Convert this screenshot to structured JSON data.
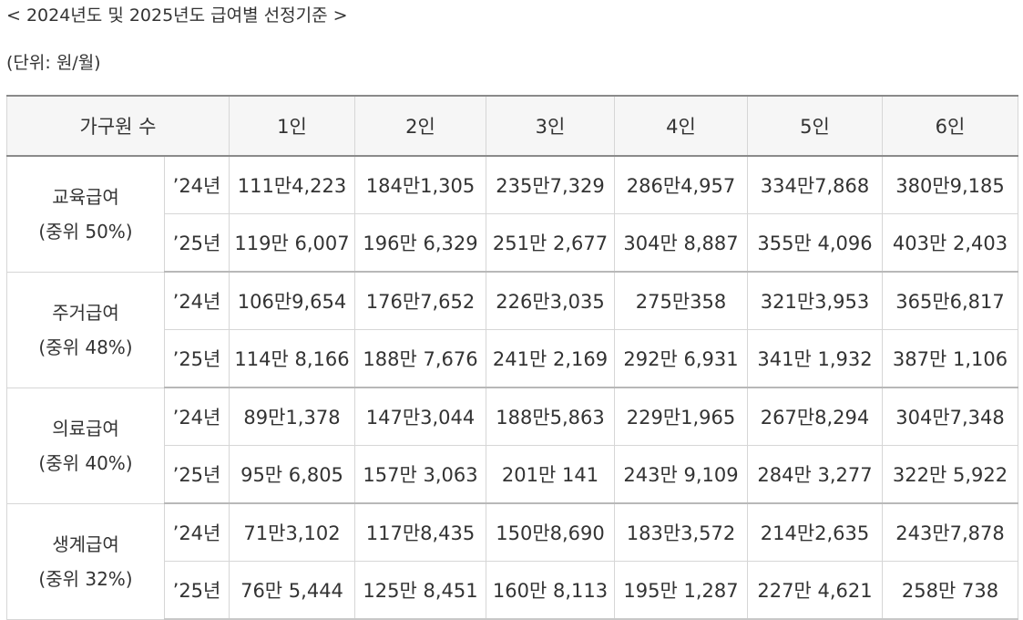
{
  "title": "< 2024년도 및 2025년도 급여별 선정기준 >",
  "unit": "(단위: 원/월)",
  "table": {
    "header_household": "가구원 수",
    "headers": [
      "1인",
      "2인",
      "3인",
      "4인",
      "5인",
      "6인"
    ],
    "groups": [
      {
        "name": "교육급여",
        "ratio": "(중위 50%)",
        "rows": [
          {
            "year": "’24년",
            "values": [
              "111만4,223",
              "184만1,305",
              "235만7,329",
              "286만4,957",
              "334만7,868",
              "380만9,185"
            ]
          },
          {
            "year": "’25년",
            "values": [
              "119만 6,007",
              "196만 6,329",
              "251만 2,677",
              "304만 8,887",
              "355만 4,096",
              "403만 2,403"
            ]
          }
        ]
      },
      {
        "name": "주거급여",
        "ratio": "(중위 48%)",
        "rows": [
          {
            "year": "’24년",
            "values": [
              "106만9,654",
              "176만7,652",
              "226만3,035",
              "275만358",
              "321만3,953",
              "365만6,817"
            ]
          },
          {
            "year": "’25년",
            "values": [
              "114만 8,166",
              "188만 7,676",
              "241만 2,169",
              "292만 6,931",
              "341만 1,932",
              "387만 1,106"
            ]
          }
        ]
      },
      {
        "name": "의료급여",
        "ratio": "(중위 40%)",
        "rows": [
          {
            "year": "’24년",
            "values": [
              "89만1,378",
              "147만3,044",
              "188만5,863",
              "229만1,965",
              "267만8,294",
              "304만7,348"
            ]
          },
          {
            "year": "’25년",
            "values": [
              "95만 6,805",
              "157만 3,063",
              "201만 141",
              "243만 9,109",
              "284만 3,277",
              "322만 5,922"
            ]
          }
        ]
      },
      {
        "name": "생계급여",
        "ratio": "(중위 32%)",
        "rows": [
          {
            "year": "’24년",
            "values": [
              "71만3,102",
              "117만8,435",
              "150만8,690",
              "183만3,572",
              "214만2,635",
              "243만7,878"
            ]
          },
          {
            "year": "’25년",
            "values": [
              "76만 5,444",
              "125만 8,451",
              "160만 8,113",
              "195만 1,287",
              "227만 4,621",
              "258만 738"
            ]
          }
        ]
      }
    ]
  }
}
